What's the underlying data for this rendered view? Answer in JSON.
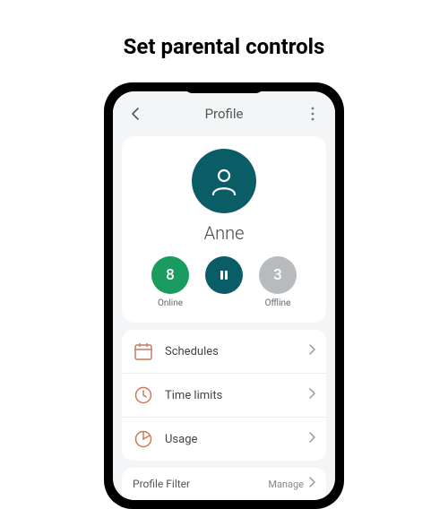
{
  "heading": "Set parental controls",
  "header": {
    "title": "Profile"
  },
  "profile": {
    "name": "Anne",
    "online": {
      "count": "8",
      "label": "Online"
    },
    "offline": {
      "count": "3",
      "label": "Offline"
    }
  },
  "menu": {
    "schedules": "Schedules",
    "time_limits": "Time limits",
    "usage": "Usage"
  },
  "filter": {
    "label": "Profile Filter",
    "action": "Manage"
  }
}
